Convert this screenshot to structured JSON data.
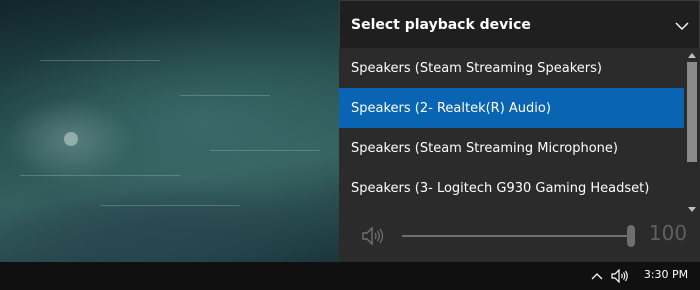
{
  "flyout": {
    "title": "Select playback device",
    "devices": [
      {
        "label": "Speakers (Steam Streaming Speakers)",
        "selected": false
      },
      {
        "label": "Speakers (2- Realtek(R) Audio)",
        "selected": true
      },
      {
        "label": "Speakers (Steam Streaming Microphone)",
        "selected": false
      },
      {
        "label": "Speakers (3- Logitech G930 Gaming Headset)",
        "selected": false
      }
    ],
    "volume": {
      "value": "100",
      "level_percent": 100
    }
  },
  "taskbar": {
    "clock": "3:30 PM",
    "icons": [
      "chevron-up-icon",
      "speaker-icon"
    ]
  },
  "colors": {
    "flyout_bg": "#2b2b2b",
    "header_bg": "#1f1f1f",
    "selected_bg": "#0a64b4",
    "taskbar_bg": "#101010"
  }
}
